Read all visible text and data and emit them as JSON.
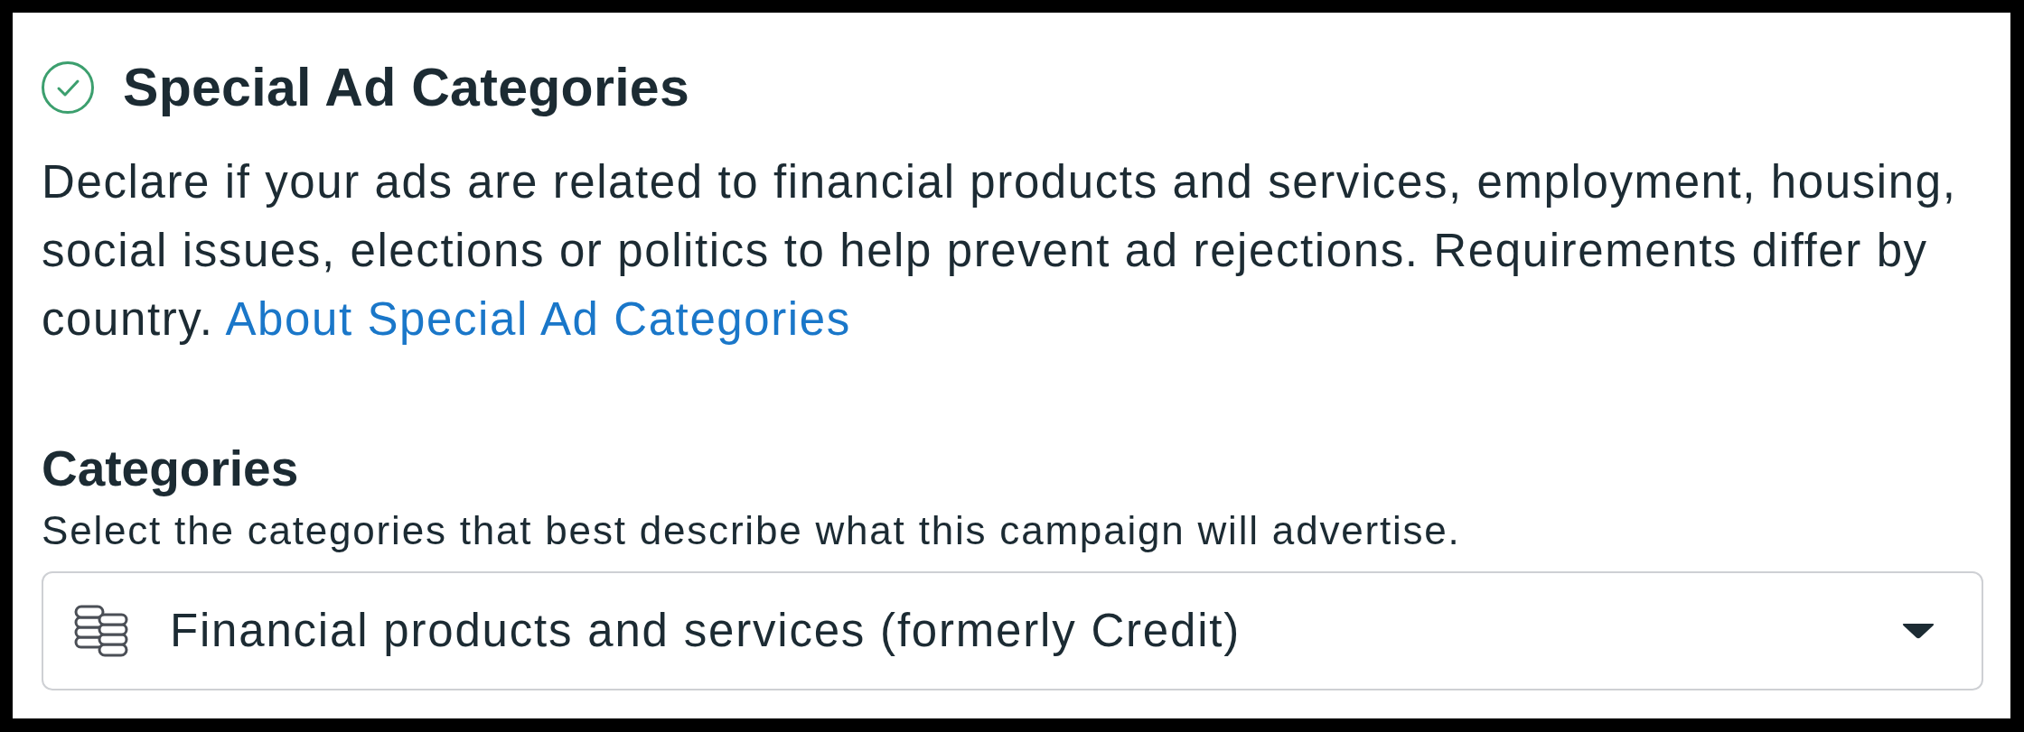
{
  "section": {
    "title": "Special Ad Categories",
    "complete": true,
    "description": "Declare if your ads are related to financial products and services, employment, housing, social issues, elections or politics to help prevent ad rejections. Requirements differ by country.",
    "link": "About Special Ad Categories"
  },
  "categories": {
    "label": "Categories",
    "hint": "Select the categories that best describe what this campaign will advertise.",
    "value": "Financial products and services (formerly Credit)"
  }
}
